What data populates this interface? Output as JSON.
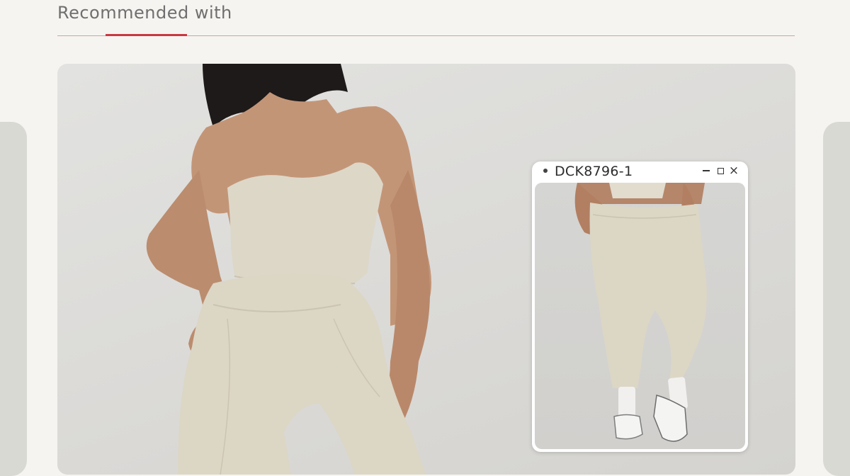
{
  "section": {
    "title": "Recommended with"
  },
  "hero": {
    "image_label": "model-wearing-strapless-top-and-leggings"
  },
  "product_card": {
    "code": "DCK8796-1",
    "controls": {
      "minimize_icon": "minimize-icon",
      "maximize_icon": "maximize-icon",
      "close_icon": "close-icon",
      "close_glyph": "×"
    }
  },
  "colors": {
    "accent": "#c9383f",
    "background": "#f6f4f1",
    "garment": "#dcd6c5"
  }
}
